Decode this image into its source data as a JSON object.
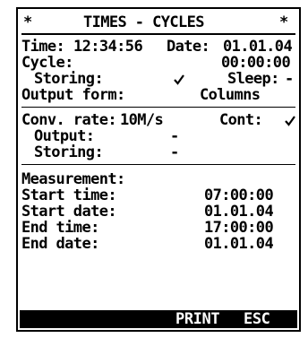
{
  "header": {
    "left_marker": "*",
    "title": "TIMES - CYCLES",
    "right_marker": "*"
  },
  "clock": {
    "time_label": "Time:",
    "time_value": "12:34:56",
    "date_label": "Date:",
    "date_value": "01.01.04"
  },
  "cycle": {
    "label": "Cycle:",
    "value": "00:00:00",
    "storing_label": "Storing:",
    "storing_checked": true,
    "sleep_label": "Sleep:",
    "sleep_value": "-"
  },
  "output_form": {
    "label": "Output form:",
    "value": "Columns"
  },
  "conversion": {
    "rate_label": "Conv. rate:",
    "rate_value": "10M/s",
    "cont_label": "Cont:",
    "cont_checked": true,
    "output_label": "Output:",
    "output_value": "-",
    "storing_label": "Storing:",
    "storing_value": "-"
  },
  "measurement": {
    "heading": "Measurement:",
    "start_time_label": "Start time:",
    "start_time_value": "07:00:00",
    "start_date_label": "Start date:",
    "start_date_value": "01.01.04",
    "end_time_label": "End time:",
    "end_time_value": "17:00:00",
    "end_date_label": "End date:",
    "end_date_value": "01.01.04"
  },
  "softkeys": {
    "print": "PRINT",
    "esc": "ESC"
  }
}
